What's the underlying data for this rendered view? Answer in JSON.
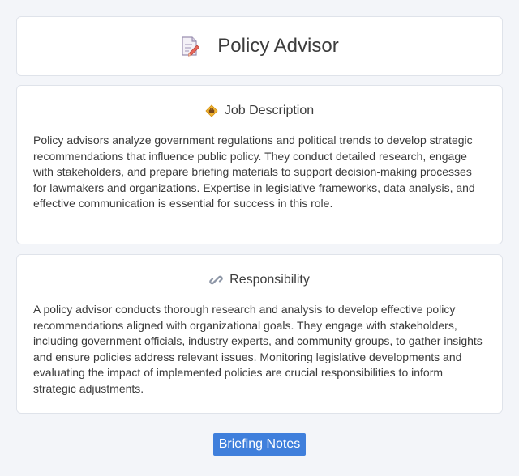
{
  "header": {
    "title": "Policy Advisor",
    "icon": "document-pencil-icon"
  },
  "job_description": {
    "heading": "Job Description",
    "icon": "briefcase-icon",
    "text": "Policy advisors analyze government regulations and political trends to develop strategic recommendations that influence public policy. They conduct detailed research, engage with stakeholders, and prepare briefing materials to support decision-making processes for lawmakers and organizations. Expertise in legislative frameworks, data analysis, and effective communication is essential for success in this role."
  },
  "responsibility": {
    "heading": "Responsibility",
    "icon": "link-icon",
    "text": "A policy advisor conducts thorough research and analysis to develop effective policy recommendations aligned with organizational goals. They engage with stakeholders, including government officials, industry experts, and community groups, to gather insights and ensure policies address relevant issues. Monitoring legislative developments and evaluating the impact of implemented policies are crucial responsibilities to inform strategic adjustments."
  },
  "footer": {
    "button_label": "Briefing Notes"
  },
  "colors": {
    "background": "#f3f5f9",
    "card": "#ffffff",
    "button": "#3f7fdc"
  }
}
